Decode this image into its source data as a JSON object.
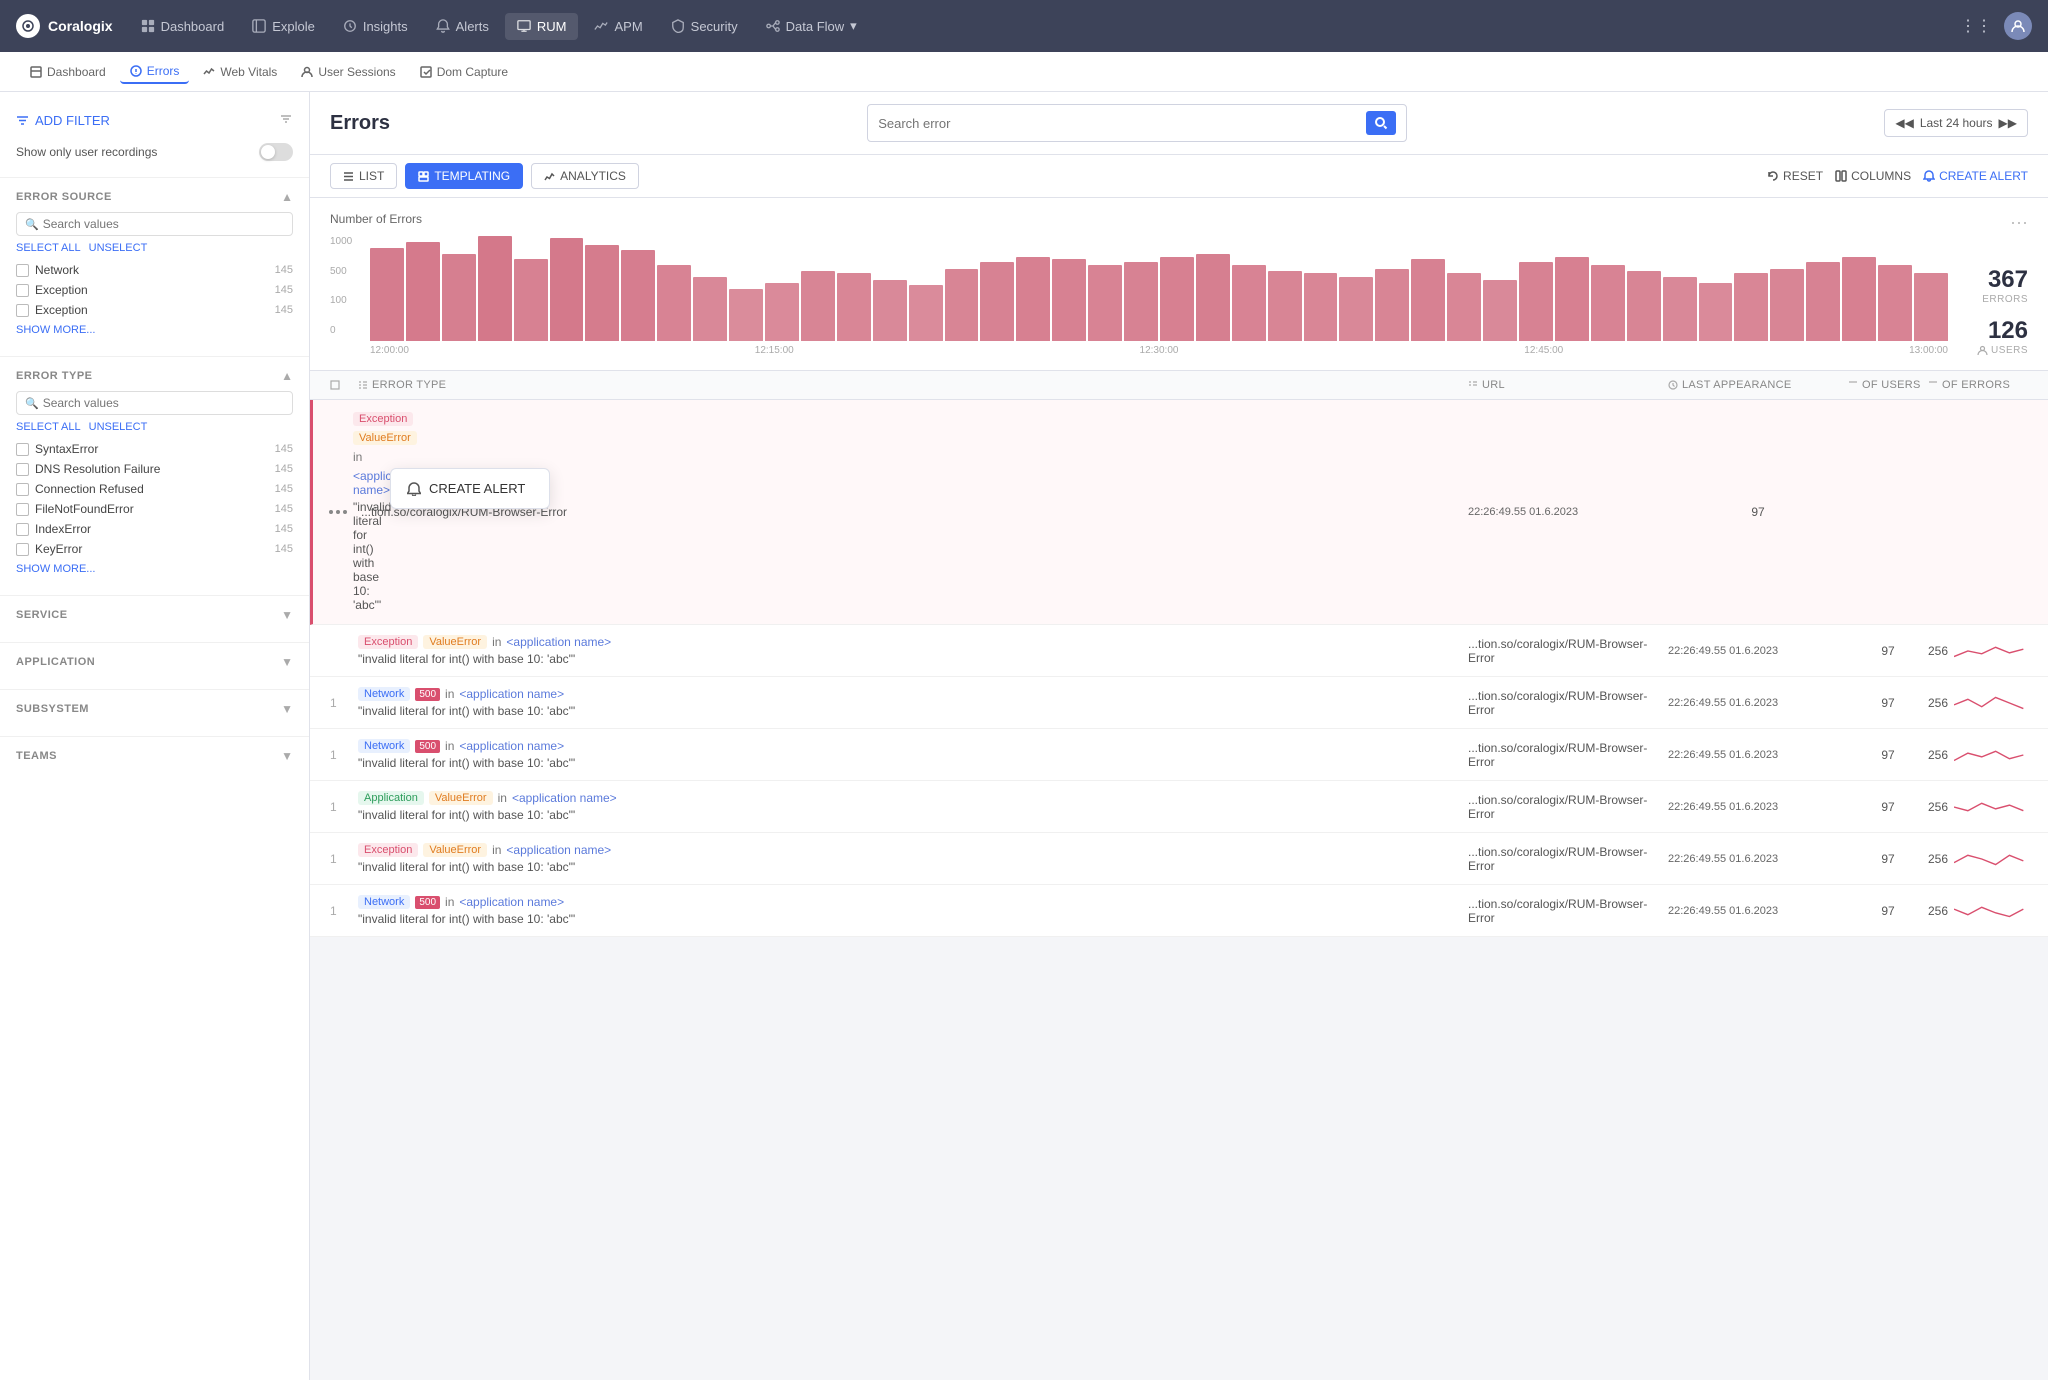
{
  "app": {
    "name": "Coralogix"
  },
  "topNav": {
    "items": [
      {
        "id": "dashboard",
        "label": "Dashboard",
        "icon": "grid"
      },
      {
        "id": "explore",
        "label": "Explole",
        "icon": "compass"
      },
      {
        "id": "insights",
        "label": "Insights",
        "icon": "lightbulb"
      },
      {
        "id": "alerts",
        "label": "Alerts",
        "icon": "bell"
      },
      {
        "id": "rum",
        "label": "RUM",
        "icon": "monitor",
        "active": true
      },
      {
        "id": "apm",
        "label": "APM",
        "icon": "chart"
      },
      {
        "id": "security",
        "label": "Security",
        "icon": "shield"
      },
      {
        "id": "dataflow",
        "label": "Data Flow",
        "icon": "flow",
        "hasArrow": true
      }
    ]
  },
  "secondaryNav": {
    "items": [
      {
        "id": "dashboard",
        "label": "Dashboard",
        "icon": "home"
      },
      {
        "id": "errors",
        "label": "Errors",
        "icon": "circle-info",
        "active": true
      },
      {
        "id": "web-vitals",
        "label": "Web Vitals",
        "icon": "chart-line"
      },
      {
        "id": "user-sessions",
        "label": "User Sessions",
        "icon": "user"
      },
      {
        "id": "dom-capture",
        "label": "Dom Capture",
        "icon": "capture"
      }
    ]
  },
  "pageTitle": "Errors",
  "searchPlaceholder": "Search error",
  "timeRange": "Last 24 hours",
  "sidebar": {
    "addFilterLabel": "ADD FILTER",
    "showOnlyRecordingsLabel": "Show only user recordings",
    "errorSource": {
      "title": "ERROR SOURCE",
      "searchPlaceholder": "Search values",
      "selectAll": "SELECT ALL",
      "unselect": "UNSELECT",
      "items": [
        {
          "label": "Network",
          "count": 145
        },
        {
          "label": "Exception",
          "count": 145
        },
        {
          "label": "Exception",
          "count": 145
        }
      ],
      "showMore": "SHOW MORE..."
    },
    "errorType": {
      "title": "ERROR TYPE",
      "searchPlaceholder": "Search values",
      "selectAll": "SELECT ALL",
      "unselect": "UNSELECT",
      "items": [
        {
          "label": "SyntaxError",
          "count": 145
        },
        {
          "label": "DNS Resolution Failure",
          "count": 145
        },
        {
          "label": "Connection Refused",
          "count": 145
        },
        {
          "label": "FileNotFoundError",
          "count": 145
        },
        {
          "label": "IndexError",
          "count": 145
        },
        {
          "label": "KeyError",
          "count": 145
        }
      ],
      "showMore": "SHOW MORE..."
    },
    "service": {
      "title": "SERVICE"
    },
    "application": {
      "title": "APPLICATION"
    },
    "subsystem": {
      "title": "SUBSYSTEM"
    },
    "teams": {
      "title": "TEAMS"
    }
  },
  "tabs": [
    {
      "id": "list",
      "label": "LIST"
    },
    {
      "id": "templating",
      "label": "TEMPLATING",
      "active": true
    },
    {
      "id": "analytics",
      "label": "ANALYTICS"
    }
  ],
  "toolbar": {
    "reset": "RESET",
    "columns": "COLUMNS",
    "createAlert": "CREATE ALERT"
  },
  "chart": {
    "title": "Number of Errors",
    "yLabels": [
      "1000",
      "500",
      "100",
      "0"
    ],
    "xLabels": [
      "12:00:00",
      "12:15:00",
      "12:30:00",
      "12:45:00",
      "13:00:00"
    ],
    "bars": [
      80,
      85,
      75,
      90,
      70,
      88,
      82,
      78,
      65,
      55,
      45,
      50,
      60,
      58,
      52,
      48,
      62,
      68,
      72,
      70,
      65,
      68,
      72,
      75,
      65,
      60,
      58,
      55,
      62,
      70,
      58,
      52,
      68,
      72,
      65,
      60,
      55,
      50,
      58,
      62,
      68,
      72,
      65,
      58
    ],
    "totalErrors": "367",
    "totalErrorsLabel": "ERRORS",
    "totalUsers": "126",
    "totalUsersLabel": "USERS"
  },
  "tableHeaders": [
    {
      "id": "num",
      "label": "#"
    },
    {
      "id": "error-type",
      "label": "ERROR TYPE"
    },
    {
      "id": "url",
      "label": "URL"
    },
    {
      "id": "last-appearance",
      "label": "LAST APPEARANCE"
    },
    {
      "id": "of-users",
      "label": "OF USERS"
    },
    {
      "id": "of-errors",
      "label": "OF ERRORS"
    }
  ],
  "tableRows": [
    {
      "num": "",
      "tags": [
        {
          "type": "exception",
          "label": "Exception"
        },
        {
          "type": "value-error",
          "label": "ValueError"
        },
        {
          "type": "app-name",
          "label": "in <application name>"
        }
      ],
      "message": "\"invalid literal for int() with base 10: 'abc'\"",
      "url": "...tion.so/coralogix/RUM-Browser-Error",
      "time": "22:26:49.55 01.6.2023",
      "users": "97",
      "errors": "",
      "isHighlighted": true
    },
    {
      "num": "",
      "tags": [
        {
          "type": "exception",
          "label": "Exception"
        },
        {
          "type": "value-error",
          "label": "ValueError"
        },
        {
          "type": "app-name",
          "label": "in <application name>"
        }
      ],
      "message": "\"invalid literal for int() with base 10: 'abc'\"",
      "url": "...tion.so/coralogix/RUM-Browser-Error",
      "time": "22:26:49.55 01.6.2023",
      "users": "97",
      "errors": "256"
    },
    {
      "num": "1",
      "tags": [
        {
          "type": "network",
          "label": "Network"
        },
        {
          "type": "500",
          "label": "500"
        },
        {
          "type": "app-name",
          "label": "in <application name>"
        }
      ],
      "message": "\"invalid literal for int() with base 10: 'abc'\"",
      "url": "...tion.so/coralogix/RUM-Browser-Error",
      "time": "22:26:49.55 01.6.2023",
      "users": "97",
      "errors": "256"
    },
    {
      "num": "1",
      "tags": [
        {
          "type": "network",
          "label": "Network"
        },
        {
          "type": "500",
          "label": "500"
        },
        {
          "type": "app-name",
          "label": "in <application name>"
        }
      ],
      "message": "\"invalid literal for int() with base 10: 'abc'\"",
      "url": "...tion.so/coralogix/RUM-Browser-Error",
      "time": "22:26:49.55 01.6.2023",
      "users": "97",
      "errors": "256"
    },
    {
      "num": "1",
      "tags": [
        {
          "type": "application",
          "label": "Application"
        },
        {
          "type": "value-error",
          "label": "ValueError"
        },
        {
          "type": "app-name",
          "label": "in <application name>"
        }
      ],
      "message": "\"invalid literal for int() with base 10: 'abc'\"",
      "url": "...tion.so/coralogix/RUM-Browser-Error",
      "time": "22:26:49.55 01.6.2023",
      "users": "97",
      "errors": "256"
    },
    {
      "num": "1",
      "tags": [
        {
          "type": "exception",
          "label": "Exception"
        },
        {
          "type": "value-error",
          "label": "ValueError"
        },
        {
          "type": "app-name",
          "label": "in <application name>"
        }
      ],
      "message": "\"invalid literal for int() with base 10: 'abc'\"",
      "url": "...tion.so/coralogix/RUM-Browser-Error",
      "time": "22:26:49.55 01.6.2023",
      "users": "97",
      "errors": "256"
    },
    {
      "num": "1",
      "tags": [
        {
          "type": "network",
          "label": "Network"
        },
        {
          "type": "500",
          "label": "500"
        },
        {
          "type": "app-name",
          "label": "in <application name>"
        }
      ],
      "message": "\"invalid literal for int() with base 10: 'abc'\"",
      "url": "...tion.so/coralogix/RUM-Browser-Error",
      "time": "22:26:49.55 01.6.2023",
      "users": "97",
      "errors": "256"
    }
  ],
  "contextMenu": {
    "createAlertLabel": "CREATE ALERT"
  }
}
